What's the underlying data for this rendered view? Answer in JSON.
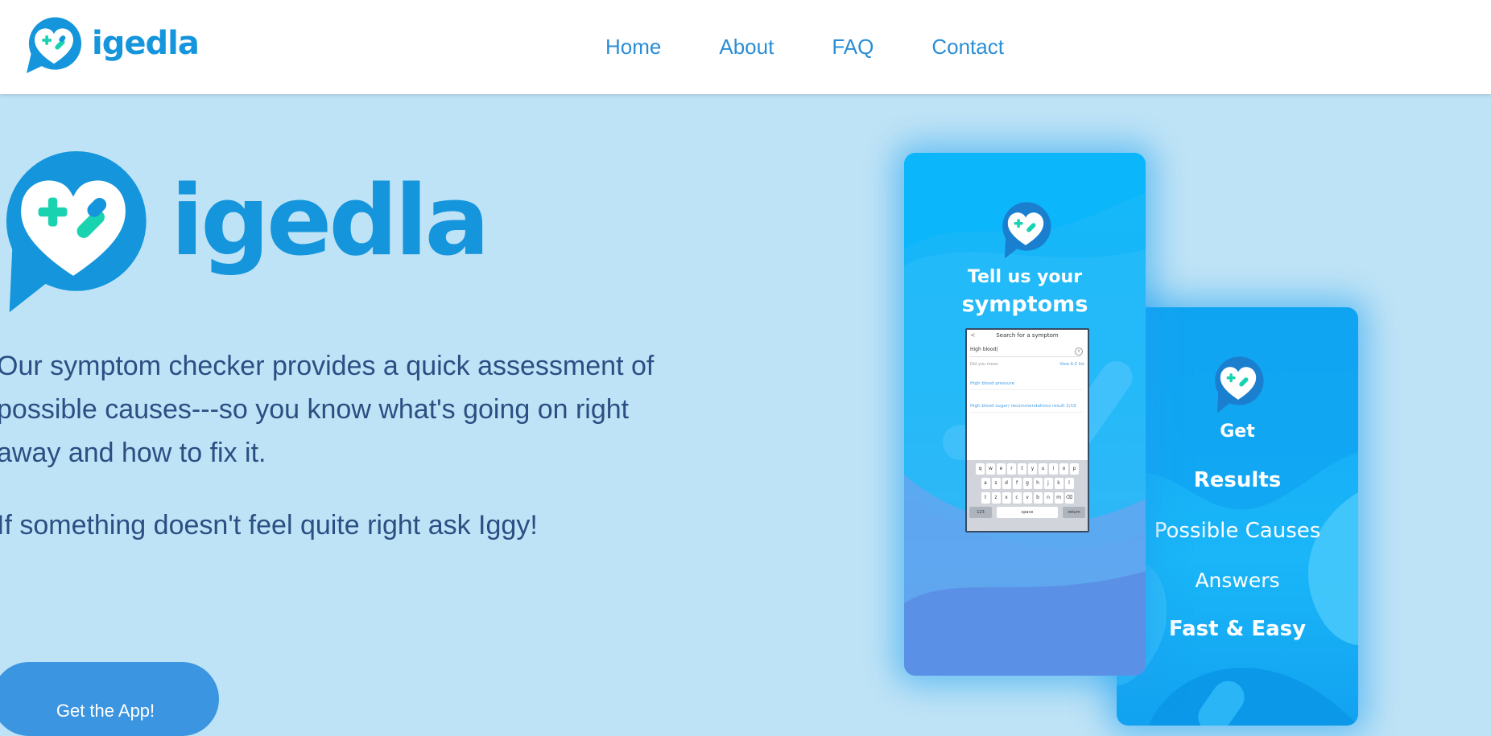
{
  "header": {
    "brand": "igedla",
    "nav": [
      "Home",
      "About",
      "FAQ",
      "Contact"
    ]
  },
  "hero": {
    "brand": "igedla",
    "paragraph1": "Our symptom checker provides a quick assessment of possible causes---so you know what's going on right away and how to fix it.",
    "paragraph2": "If something doesn't feel quite right ask Iggy!",
    "cta": "Get the App!"
  },
  "card1": {
    "line1": "Tell us your",
    "line2": "symptoms",
    "screen": {
      "back": "<",
      "title": "Search for a symptom",
      "input_value": "High blood|",
      "clear": "x",
      "did_you_mean": "Did you mean",
      "view_all": "View A-Z list",
      "results": [
        "High blood pressure",
        "High blood sugar/ recommendations result 2/19"
      ],
      "keyboard_rows": [
        [
          "q",
          "w",
          "e",
          "r",
          "t",
          "y",
          "u",
          "i",
          "o",
          "p"
        ],
        [
          "a",
          "s",
          "d",
          "f",
          "g",
          "h",
          "j",
          "k",
          "l"
        ],
        [
          "⇧",
          "z",
          "x",
          "c",
          "v",
          "b",
          "n",
          "m",
          "⌫"
        ]
      ],
      "key_123": "123",
      "key_space": "space",
      "key_return": "return"
    }
  },
  "card2": {
    "get": "Get",
    "results": "Results",
    "possible_causes": "Possible Causes",
    "answers": "Answers",
    "fast_easy": "Fast & Easy"
  },
  "colors": {
    "brand_blue": "#1595dc",
    "page_bg": "#bfe3f6",
    "nav_link": "#2a8ed6",
    "text": "#2a4f83",
    "button": "#3c95e0",
    "heart_accent": "#19d3b0"
  },
  "icons": {
    "logo": "chat-bubble-heart-logo-icon"
  }
}
